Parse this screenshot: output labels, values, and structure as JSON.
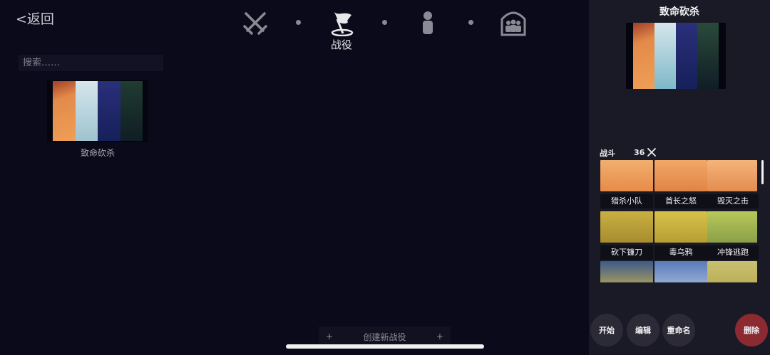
{
  "nav": {
    "back": "<返回",
    "active_label": "战役",
    "icons": [
      "crossed-swords-icon",
      "flag-icon",
      "person-icon",
      "group-icon"
    ]
  },
  "search": {
    "placeholder": "搜索……",
    "value": ""
  },
  "campaigns": [
    {
      "name": "致命砍杀"
    }
  ],
  "create_button": {
    "plus_left": "+",
    "label": "创建新战役",
    "plus_right": "+"
  },
  "panel": {
    "title": "致命砍杀",
    "battles_label": "战斗",
    "battles_count": "36",
    "battles": [
      {
        "name": "猎杀小队"
      },
      {
        "name": "首长之怒"
      },
      {
        "name": "毁灭之击"
      },
      {
        "name": "砍下镰刀"
      },
      {
        "name": "毒乌鸦"
      },
      {
        "name": "冲锋逃跑"
      },
      {
        "name": ""
      },
      {
        "name": ""
      },
      {
        "name": ""
      }
    ],
    "actions": {
      "start": "开始",
      "edit": "编辑",
      "rename": "重命名",
      "delete": "删除"
    }
  },
  "colors": {
    "background": "#0b0a1a",
    "panel": "#1a1a26",
    "delete": "#8b2a30",
    "strip_orange": "#e38a4a",
    "strip_light": "#b9d6e0",
    "strip_blue": "#1d2a6b",
    "strip_green": "#1d3d2e"
  }
}
